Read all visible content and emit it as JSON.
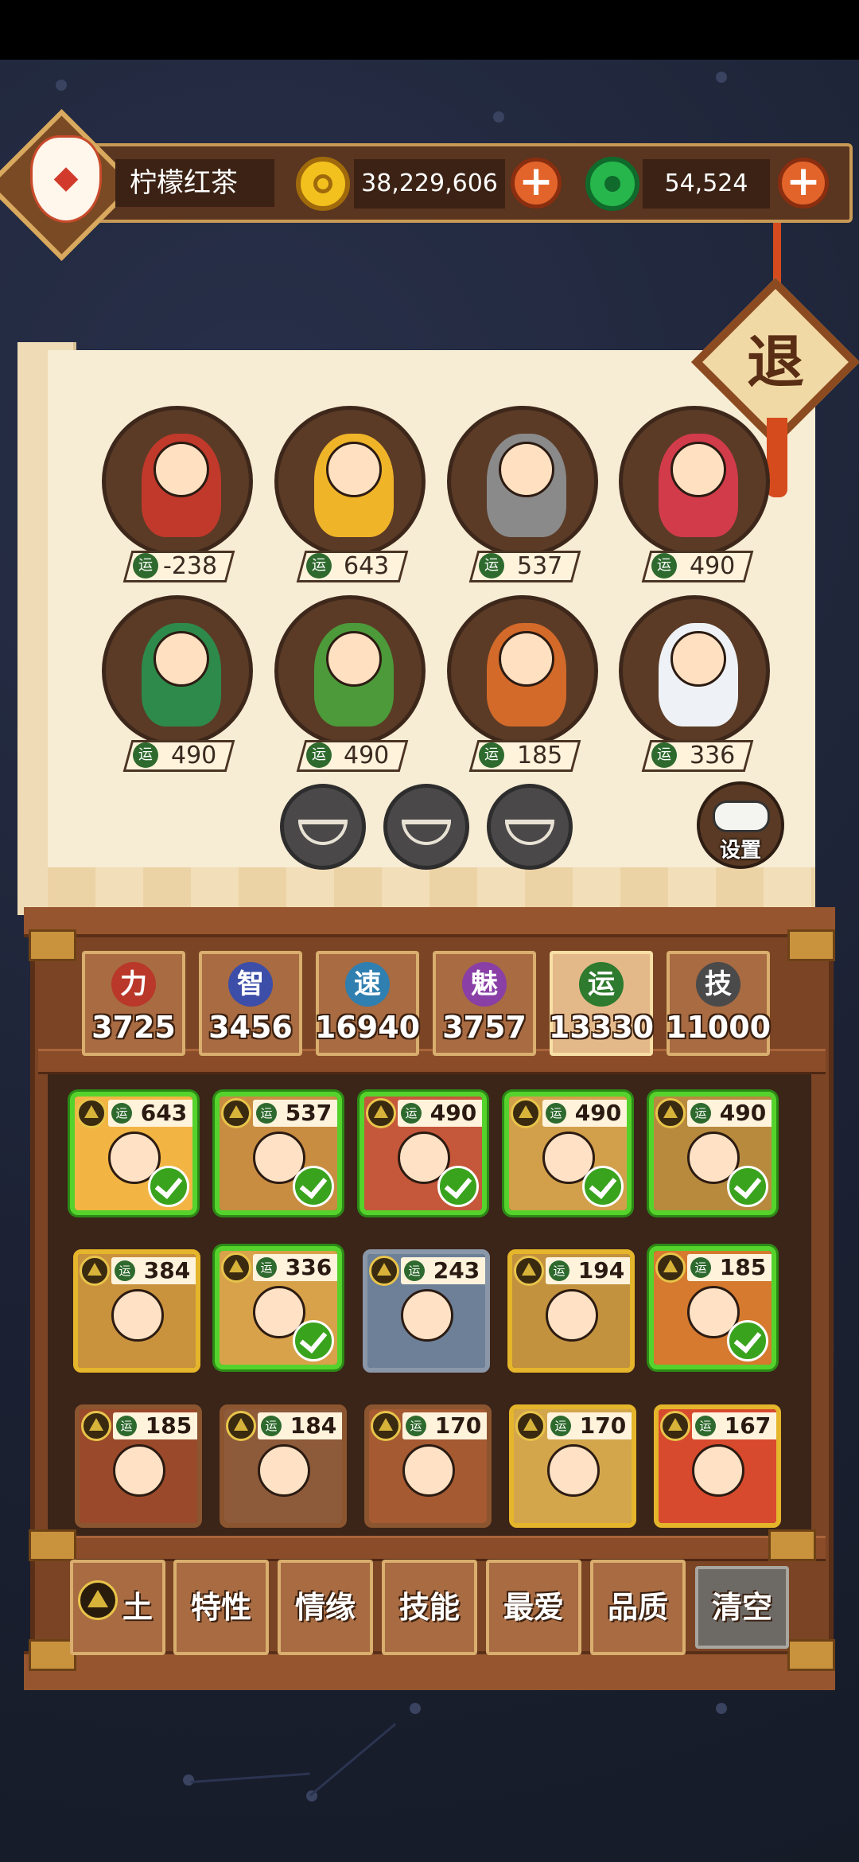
{
  "user": {
    "name": "柠檬红茶"
  },
  "currency": {
    "gold": {
      "amount": "38,229,606",
      "icon": "gold-coin-icon"
    },
    "jade": {
      "amount": "54,524",
      "icon": "jade-coin-icon"
    }
  },
  "exit_button": {
    "label": "退"
  },
  "luck_label": "运",
  "featured": [
    {
      "luck": "-238"
    },
    {
      "luck": "643"
    },
    {
      "luck": "537"
    },
    {
      "luck": "490"
    },
    {
      "luck": "490"
    },
    {
      "luck": "490"
    },
    {
      "luck": "185"
    },
    {
      "luck": "336"
    }
  ],
  "settings": {
    "label": "设置",
    "icon": "gamepad-icon"
  },
  "stats": [
    {
      "label": "力",
      "value": "3725",
      "color": "#b9382a"
    },
    {
      "label": "智",
      "value": "3456",
      "color": "#3d4ea8"
    },
    {
      "label": "速",
      "value": "16940",
      "color": "#2f7fb0"
    },
    {
      "label": "魅",
      "value": "3757",
      "color": "#8a3fa6"
    },
    {
      "label": "运",
      "value": "13330",
      "color": "#2e7a2e",
      "selected": true
    },
    {
      "label": "技",
      "value": "11000",
      "color": "#4a4a4a"
    }
  ],
  "heroes": [
    {
      "luck": "643",
      "selected": true
    },
    {
      "luck": "537",
      "selected": true
    },
    {
      "luck": "490",
      "selected": true
    },
    {
      "luck": "490",
      "selected": true
    },
    {
      "luck": "490",
      "selected": true
    },
    {
      "luck": "384",
      "selected": false
    },
    {
      "luck": "336",
      "selected": true
    },
    {
      "luck": "243",
      "selected": false
    },
    {
      "luck": "194",
      "selected": false
    },
    {
      "luck": "185",
      "selected": true
    },
    {
      "luck": "185",
      "selected": false
    },
    {
      "luck": "184",
      "selected": false
    },
    {
      "luck": "170",
      "selected": false
    },
    {
      "luck": "170",
      "selected": false
    },
    {
      "luck": "167",
      "selected": false
    }
  ],
  "filters": {
    "element": "土",
    "trait": "特性",
    "bond": "情缘",
    "skill": "技能",
    "favorite": "最爱",
    "quality": "品质",
    "clear": "清空"
  }
}
